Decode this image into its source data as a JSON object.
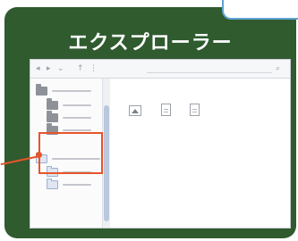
{
  "panel": {
    "title": "エクスプローラー"
  },
  "toolbar": {
    "glyphs": [
      "◂",
      "▸",
      "⌄",
      "↑",
      "⋮",
      "⌕"
    ]
  },
  "colors": {
    "panel_bg": "#2f5b2f",
    "highlight": "#e8542a",
    "bubble_border": "#5fa3d1",
    "folder_gray": "#8e9198",
    "folder_blue": "#dfe6f2"
  },
  "nav_pane": {
    "items": [
      {
        "icon": "folder-icon",
        "indent": 0
      },
      {
        "icon": "folder-icon",
        "indent": 1
      },
      {
        "icon": "folder-icon",
        "indent": 1
      },
      {
        "icon": "folder-icon",
        "indent": 1
      },
      {
        "icon": "folder-open-icon",
        "indent": 0,
        "highlighted": true
      },
      {
        "icon": "folder-light-icon",
        "indent": 1,
        "highlighted": true
      },
      {
        "icon": "folder-light-icon",
        "indent": 1,
        "highlighted": true
      }
    ]
  },
  "main_pane": {
    "items": [
      {
        "icon": "image-file-icon"
      },
      {
        "icon": "document-file-icon"
      },
      {
        "icon": "document-file-icon"
      }
    ]
  }
}
